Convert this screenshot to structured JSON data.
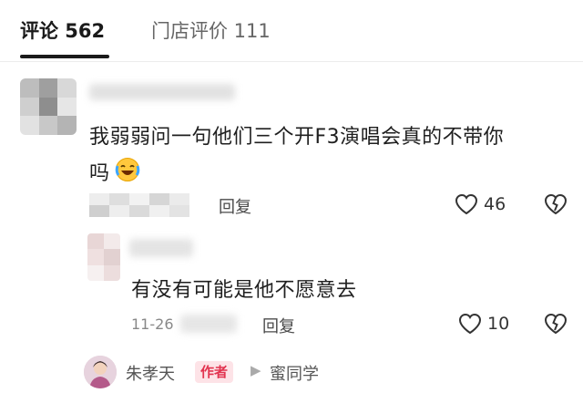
{
  "tabs": {
    "comments_label": "评论 562",
    "reviews_label": "门店评价 111"
  },
  "comment": {
    "text_line1": "我弱弱问一句他们三个开F3演唱会真的不带你",
    "text_line2": "吗",
    "reply_label": "回复",
    "likes": "46"
  },
  "reply": {
    "text": "有没有可能是他不愿意去",
    "date": "11-26",
    "reply_label": "回复",
    "likes": "10"
  },
  "author_reply": {
    "author_name": "朱孝天",
    "badge": "作者",
    "reply_to": "蜜同学"
  },
  "icons": {
    "like": "heart-outline-icon",
    "dislike": "broken-heart-icon",
    "emoji": "laughing-crying-emoji",
    "arrow": "play-triangle-icon"
  },
  "colors": {
    "badge_text": "#e2334f",
    "badge_bg": "#fde3e7"
  }
}
